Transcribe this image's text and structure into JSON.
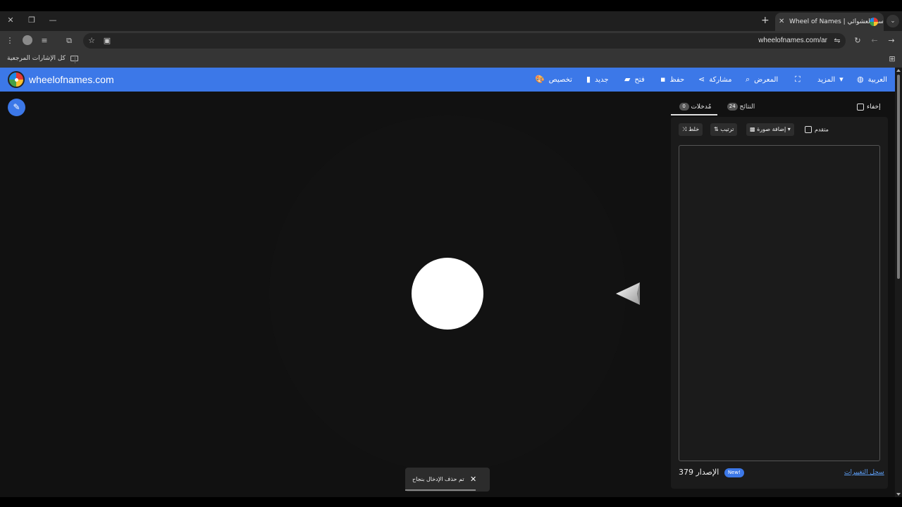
{
  "browser": {
    "tab_title": "Wheel of Names | سم العشوائي",
    "url": "wheelofnames.com/ar",
    "bookmarks_label": "كل الإشارات المرجعية"
  },
  "app": {
    "brand": "wheelofnames.com",
    "nav": {
      "language": "العربية",
      "more": "المزيد",
      "gallery": "المعرض",
      "share": "مشاركة",
      "save": "حفظ",
      "open": "فتح",
      "new": "جديد",
      "customize": "تخصيص"
    }
  },
  "panel": {
    "hide_label": "إخفاء",
    "tab_entries_label": "مُدخلات",
    "tab_entries_count": "0",
    "tab_results_label": "النتائج",
    "tab_results_count": "24",
    "shuffle_label": "خلط",
    "sort_label": "ترتيب",
    "add_image_label": "إضافة صورة",
    "advanced_label": "متقدم",
    "version_label": "الإصدار",
    "version_number": "379",
    "new_badge": "New!",
    "changelog_link": "سجل التغييرات"
  },
  "snackbar": {
    "message": "تم حذف الإدخال بنجاح"
  },
  "colors": {
    "accent": "#3c78e8",
    "page_bg": "#111111",
    "panel_bg": "#1b1b1b"
  }
}
